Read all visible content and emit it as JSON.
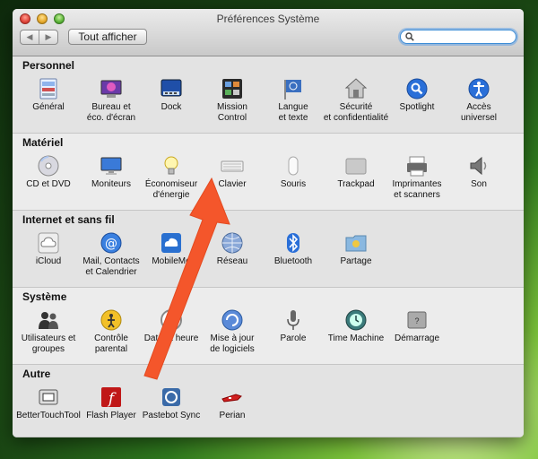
{
  "window": {
    "title": "Préférences Système"
  },
  "toolbar": {
    "back": "◀",
    "forward": "▶",
    "show_all": "Tout afficher",
    "search_value": "",
    "search_placeholder": ""
  },
  "sections": [
    {
      "title": "Personnel",
      "panes": [
        {
          "label_lines": [
            "Général"
          ],
          "icon": "general-icon"
        },
        {
          "label_lines": [
            "Bureau et",
            "éco. d'écran"
          ],
          "icon": "desktop-screensaver-icon"
        },
        {
          "label_lines": [
            "Dock"
          ],
          "icon": "dock-icon"
        },
        {
          "label_lines": [
            "Mission",
            "Control"
          ],
          "icon": "mission-control-icon"
        },
        {
          "label_lines": [
            "Langue",
            "et texte"
          ],
          "icon": "language-flag-icon"
        },
        {
          "label_lines": [
            "Sécurité",
            "et confidentialité"
          ],
          "icon": "security-house-icon"
        },
        {
          "label_lines": [
            "Spotlight"
          ],
          "icon": "spotlight-icon"
        },
        {
          "label_lines": [
            "Accès",
            "universel"
          ],
          "icon": "accessibility-icon"
        }
      ]
    },
    {
      "title": "Matériel",
      "panes": [
        {
          "label_lines": [
            "CD et DVD"
          ],
          "icon": "cd-dvd-icon"
        },
        {
          "label_lines": [
            "Moniteurs"
          ],
          "icon": "monitor-icon"
        },
        {
          "label_lines": [
            "Économiseur",
            "d'énergie"
          ],
          "icon": "lightbulb-icon"
        },
        {
          "label_lines": [
            "Clavier"
          ],
          "icon": "keyboard-icon"
        },
        {
          "label_lines": [
            "Souris"
          ],
          "icon": "mouse-icon"
        },
        {
          "label_lines": [
            "Trackpad"
          ],
          "icon": "trackpad-icon"
        },
        {
          "label_lines": [
            "Imprimantes",
            "et scanners"
          ],
          "icon": "printer-icon"
        },
        {
          "label_lines": [
            "Son"
          ],
          "icon": "speaker-icon"
        }
      ]
    },
    {
      "title": "Internet et sans fil",
      "panes": [
        {
          "label_lines": [
            "iCloud"
          ],
          "icon": "icloud-icon"
        },
        {
          "label_lines": [
            "Mail, Contacts",
            "et Calendrier"
          ],
          "icon": "at-sign-icon"
        },
        {
          "label_lines": [
            "MobileMe"
          ],
          "icon": "mobileme-icon"
        },
        {
          "label_lines": [
            "Réseau"
          ],
          "icon": "network-globe-icon"
        },
        {
          "label_lines": [
            "Bluetooth"
          ],
          "icon": "bluetooth-icon"
        },
        {
          "label_lines": [
            "Partage"
          ],
          "icon": "sharing-folder-icon"
        }
      ]
    },
    {
      "title": "Système",
      "panes": [
        {
          "label_lines": [
            "Utilisateurs et",
            "groupes"
          ],
          "icon": "users-icon"
        },
        {
          "label_lines": [
            "Contrôle",
            "parental"
          ],
          "icon": "parental-controls-icon"
        },
        {
          "label_lines": [
            "Date et heure"
          ],
          "icon": "clock-icon"
        },
        {
          "label_lines": [
            "Mise à jour",
            "de logiciels"
          ],
          "icon": "software-update-icon"
        },
        {
          "label_lines": [
            "Parole"
          ],
          "icon": "microphone-icon"
        },
        {
          "label_lines": [
            "Time Machine"
          ],
          "icon": "time-machine-icon"
        },
        {
          "label_lines": [
            "Démarrage"
          ],
          "icon": "startup-disk-icon"
        }
      ]
    },
    {
      "title": "Autre",
      "panes": [
        {
          "label_lines": [
            "BetterTouchTool"
          ],
          "icon": "bettertouchtool-icon"
        },
        {
          "label_lines": [
            "Flash Player"
          ],
          "icon": "flash-player-icon"
        },
        {
          "label_lines": [
            "Pastebot Sync"
          ],
          "icon": "pastebot-sync-icon"
        },
        {
          "label_lines": [
            "Perian"
          ],
          "icon": "perian-knife-icon"
        }
      ]
    }
  ]
}
